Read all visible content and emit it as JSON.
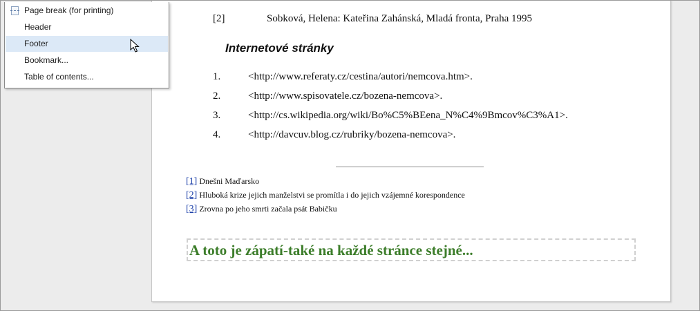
{
  "menu": {
    "items": [
      {
        "label": "Page break (for printing)",
        "icon": "page-break-icon"
      },
      {
        "label": "Header"
      },
      {
        "label": "Footer",
        "highlighted": true
      },
      {
        "label": "Bookmark..."
      },
      {
        "label": "Table of contents..."
      }
    ]
  },
  "document": {
    "reference": {
      "num": "[2]",
      "text": "Sobková, Helena: Kateřina Zahánská, Mladá fronta, Praha 1995"
    },
    "section_heading": "Internetové stránky",
    "links": [
      {
        "num": "1.",
        "text": "<http://www.referaty.cz/cestina/autori/nemcova.htm>."
      },
      {
        "num": "2.",
        "text": "<http://www.spisovatele.cz/bozena-nemcova>."
      },
      {
        "num": "3.",
        "text": "<http://cs.wikipedia.org/wiki/Bo%C5%BEena_N%C4%9Bmcov%C3%A1>."
      },
      {
        "num": "4.",
        "text": "<http://davcuv.blog.cz/rubriky/bozena-nemcova>."
      }
    ],
    "footnotes": [
      {
        "ref": "[1]",
        "text": "Dnešni Maďarsko"
      },
      {
        "ref": "[2]",
        "text": "Hluboká krize jejich manželstvi se promítla i do jejich vzájemné korespondence"
      },
      {
        "ref": "[3]",
        "text": "Zrovna po jeho smrti začala psát Babičku"
      }
    ],
    "footer_text": "A toto je zápatí-také na každé stránce stejné..."
  },
  "colors": {
    "footer_text": "#3c7d2a",
    "menu_highlight": "#dce9f7",
    "footnote_link": "#1a3ea8"
  }
}
